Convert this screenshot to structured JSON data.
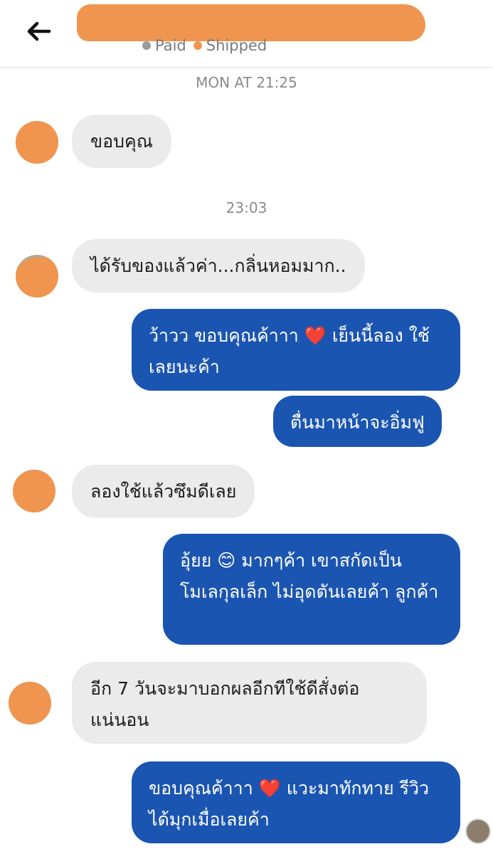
{
  "header": {
    "title": "",
    "status": [
      {
        "label": "Paid",
        "color": "#9a9a9a"
      },
      {
        "label": "Shipped",
        "color": "#f0954f"
      }
    ]
  },
  "timestamps": [
    "MON AT 21:25",
    "23:03"
  ],
  "messages": [
    {
      "side": "in",
      "text": "ขอบคุณ"
    },
    {
      "side": "in",
      "text": "ได้รับของแล้วค่า...กลิ่นหอมมาก.."
    },
    {
      "side": "out",
      "text": "ว้าวว ขอบคุณค้าาา ❤️ เย็นนี้ลอง ใช้เลยนะค้า"
    },
    {
      "side": "out",
      "text": "ตื่นมาหน้าจะอิ่มฟู"
    },
    {
      "side": "in",
      "text": "ลองใช้แล้วซึมดีเลย"
    },
    {
      "side": "out",
      "text": "อุ้ยย 😊 มากๆค้า เขาสกัดเป็น โมเลกุลเล็ก ไม่อุดตันเลยค้า ลูกค้า"
    },
    {
      "side": "in",
      "text": "อีก 7 วันจะมาบอกผลอีกทีใช้ดีสั่งต่อ แน่นอน"
    },
    {
      "side": "out",
      "text": "ขอบคุณค้าาา ❤️ แวะมาทักทาย รีวิวได้มุกเมื่อเลยค้า"
    }
  ],
  "colors": {
    "outgoing": "#1b55b2",
    "incoming": "#ebebeb",
    "redaction": "#f0954f"
  },
  "icons": {
    "back": "back-arrow-icon"
  }
}
